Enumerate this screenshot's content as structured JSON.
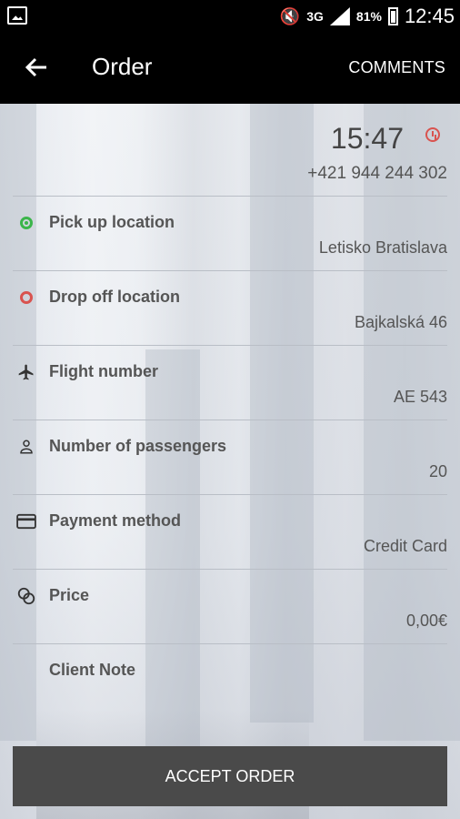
{
  "status_bar": {
    "network": "3G",
    "battery": "81%",
    "time": "12:45"
  },
  "app_bar": {
    "title": "Order",
    "comments_label": "COMMENTS"
  },
  "order": {
    "time": "15:47",
    "phone": "+421 944 244 302",
    "fields": [
      {
        "label": "Pick up location",
        "value": "Letisko Bratislava",
        "icon": "pickup-circle-icon"
      },
      {
        "label": "Drop off location",
        "value": "Bajkalská 46",
        "icon": "dropoff-circle-icon"
      },
      {
        "label": "Flight number",
        "value": "AE 543",
        "icon": "airplane-icon"
      },
      {
        "label": "Number of passengers",
        "value": "20",
        "icon": "person-icon"
      },
      {
        "label": "Payment method",
        "value": "Credit Card",
        "icon": "credit-card-icon"
      },
      {
        "label": "Price",
        "value": "0,00€",
        "icon": "coins-icon"
      }
    ],
    "client_note_label": "Client Note"
  },
  "accept_button": {
    "label": "ACCEPT ORDER"
  },
  "colors": {
    "pickup": "#3bb54a",
    "dropoff": "#d9534f",
    "button": "#4a4a4a",
    "bar": "#000000"
  }
}
